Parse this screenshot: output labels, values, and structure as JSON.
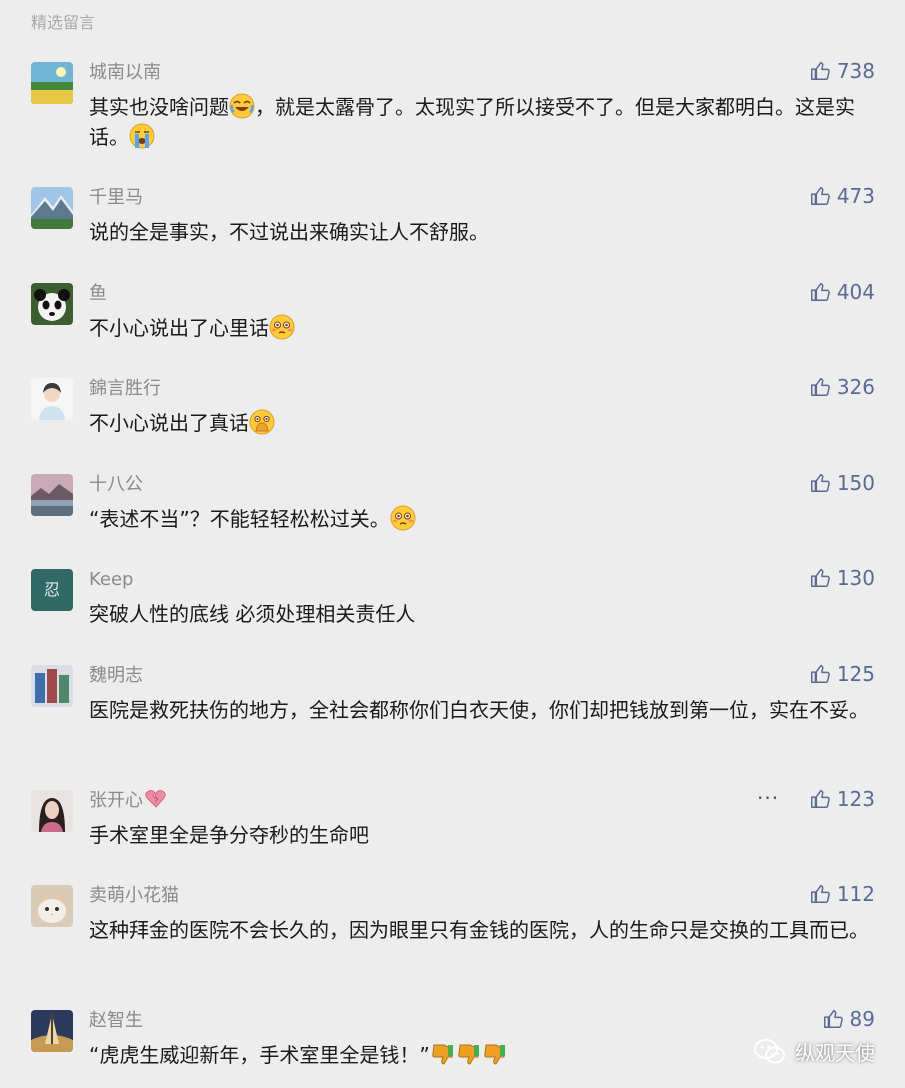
{
  "section_title": "精选留言",
  "comments": [
    {
      "nickname": "城南以南",
      "likes": "738",
      "text_a": "其实也没啥问题",
      "text_b": "，就是太露骨了。太现实了所以接受不了。但是大家都明白。这是实话。",
      "emoji_a": "face-with-tears-of-joy",
      "emoji_b": "loudly-crying-face"
    },
    {
      "nickname": "千里马",
      "likes": "473",
      "text": "说的全是事实，不过说出来确实让人不舒服。"
    },
    {
      "nickname": "鱼",
      "likes": "404",
      "text": "不小心说出了心里话",
      "emoji": "flushed-face"
    },
    {
      "nickname": "錦言胜行",
      "likes": "326",
      "text": "不小心说出了真话",
      "emoji": "face-with-hand-over-mouth"
    },
    {
      "nickname": "十八公",
      "likes": "150",
      "text": "“表述不当”？不能轻轻松松过关。",
      "emoji": "flushed-face"
    },
    {
      "nickname": "Keep",
      "likes": "130",
      "text": "突破人性的底线 必须处理相关责任人",
      "avatar_glyph": "忍"
    },
    {
      "nickname": "魏明志",
      "likes": "125",
      "text": "医院是救死扶伤的地方，全社会都称你们白衣天使，你们却把钱放到第一位，实在不妥。"
    },
    {
      "nickname": "张开心",
      "likes": "123",
      "text": "手术室里全是争分夺秒的生命吧",
      "more": "···",
      "nick_icon": "broken-heart-icon"
    },
    {
      "nickname": "卖萌小花猫",
      "likes": "112",
      "text": "这种拜金的医院不会长久的，因为眼里只有金钱的医院，人的生命只是交换的工具而已。"
    },
    {
      "nickname": "赵智生",
      "likes": "89",
      "text": "“虎虎生威迎新年，手术室里全是钱！”",
      "emoji": "thumbs-down-x3"
    }
  ],
  "watermark": "纵观天使",
  "colors": {
    "background": "#ededed",
    "nickname": "#8a8a8a",
    "body_text": "#1a1a1a",
    "like_count": "#576b95",
    "section_title": "#a8a8a8"
  }
}
